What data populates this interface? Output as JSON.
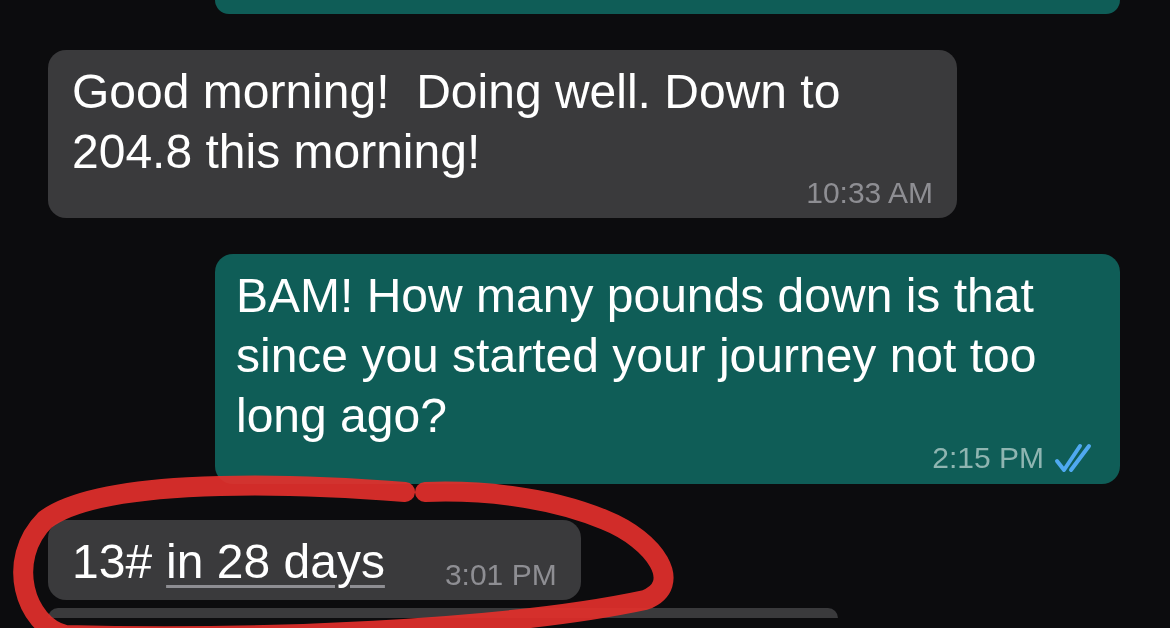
{
  "messages": [
    {
      "kind": "partial",
      "outgoing": true
    },
    {
      "kind": "message",
      "outgoing": false,
      "text": "Good morning!  Doing well. Down to 204.8 this morning!",
      "time": "10:33 AM"
    },
    {
      "kind": "message",
      "outgoing": true,
      "text": "BAM! How many pounds down is that since you started your journey not too long ago?",
      "time": "2:15 PM",
      "read": true
    },
    {
      "kind": "message",
      "outgoing": false,
      "text": "13#",
      "link": "in 28 days",
      "time": "3:01 PM"
    },
    {
      "kind": "partial",
      "outgoing": false
    }
  ]
}
